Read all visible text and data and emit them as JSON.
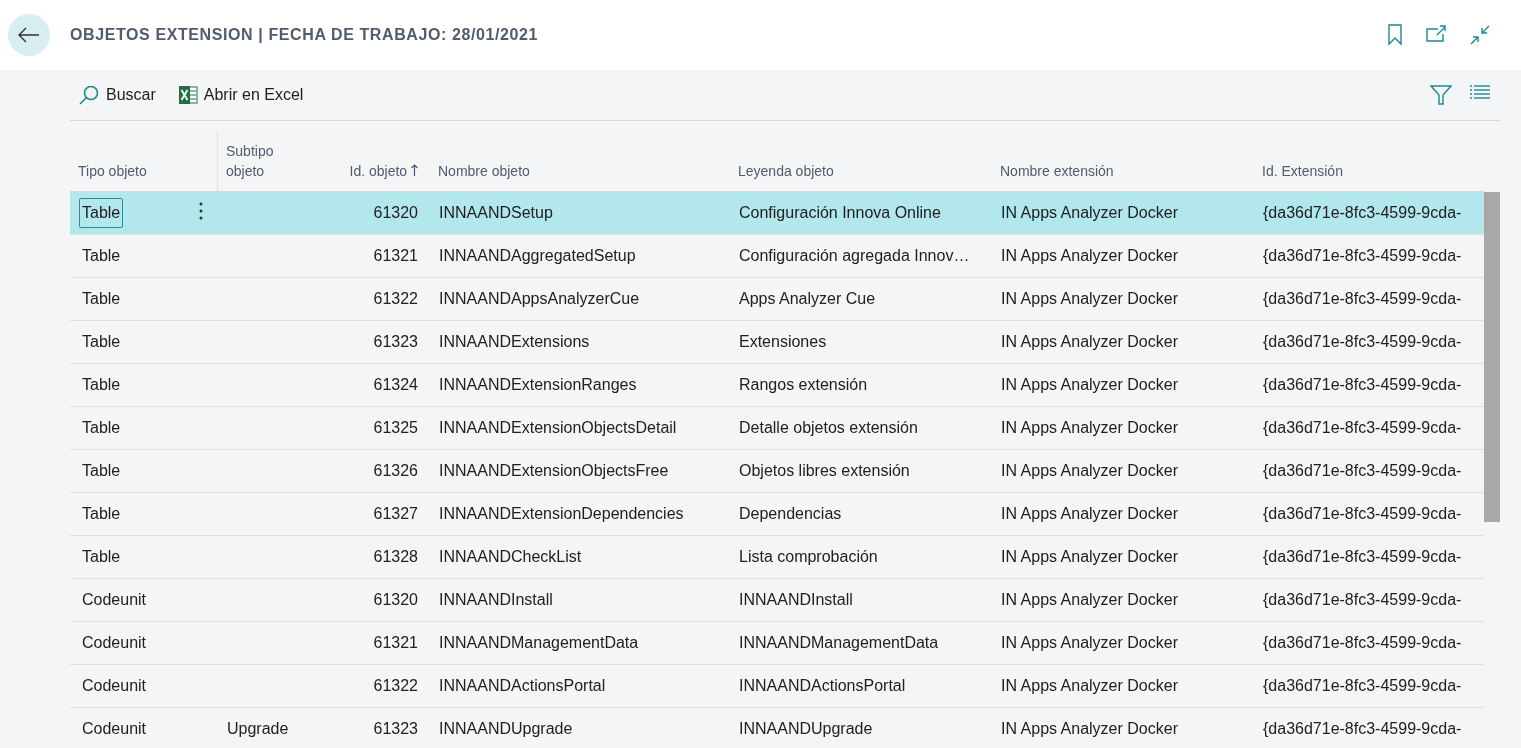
{
  "window": {
    "title": "OBJETOS EXTENSION | FECHA DE TRABAJO: 28/01/2021"
  },
  "toolbar": {
    "actions": [
      {
        "kind": "search",
        "label": "Buscar"
      },
      {
        "kind": "excel",
        "label": "Abrir en Excel"
      }
    ]
  },
  "table": {
    "columns": [
      {
        "label": "Tipo objeto",
        "kind": "text",
        "sorted": false
      },
      {
        "label": "Subtipo objeto",
        "kind": "text",
        "sorted": false
      },
      {
        "label": "Id. objeto",
        "kind": "number",
        "sorted": true
      },
      {
        "label": "Nombre objeto",
        "kind": "text",
        "sorted": false
      },
      {
        "label": "Leyenda objeto",
        "kind": "text",
        "sorted": false
      },
      {
        "label": "Nombre extensión",
        "kind": "text",
        "sorted": false
      },
      {
        "label": "Id. Extensión",
        "kind": "text",
        "sorted": false
      }
    ],
    "rows": [
      {
        "selected": true,
        "cells": [
          "Table",
          "",
          "61320",
          "INNAANDSetup",
          "Configuración Innova Online",
          "IN Apps Analyzer Docker",
          "{da36d71e-8fc3-4599-9cda-"
        ]
      },
      {
        "selected": false,
        "cells": [
          "Table",
          "",
          "61321",
          "INNAANDAggregatedSetup",
          "Configuración agregada Innov…",
          "IN Apps Analyzer Docker",
          "{da36d71e-8fc3-4599-9cda-"
        ]
      },
      {
        "selected": false,
        "cells": [
          "Table",
          "",
          "61322",
          "INNAANDAppsAnalyzerCue",
          "Apps Analyzer Cue",
          "IN Apps Analyzer Docker",
          "{da36d71e-8fc3-4599-9cda-"
        ]
      },
      {
        "selected": false,
        "cells": [
          "Table",
          "",
          "61323",
          "INNAANDExtensions",
          "Extensiones",
          "IN Apps Analyzer Docker",
          "{da36d71e-8fc3-4599-9cda-"
        ]
      },
      {
        "selected": false,
        "cells": [
          "Table",
          "",
          "61324",
          "INNAANDExtensionRanges",
          "Rangos extensión",
          "IN Apps Analyzer Docker",
          "{da36d71e-8fc3-4599-9cda-"
        ]
      },
      {
        "selected": false,
        "cells": [
          "Table",
          "",
          "61325",
          "INNAANDExtensionObjectsDetail",
          "Detalle objetos extensión",
          "IN Apps Analyzer Docker",
          "{da36d71e-8fc3-4599-9cda-"
        ]
      },
      {
        "selected": false,
        "cells": [
          "Table",
          "",
          "61326",
          "INNAANDExtensionObjectsFree",
          "Objetos libres extensión",
          "IN Apps Analyzer Docker",
          "{da36d71e-8fc3-4599-9cda-"
        ]
      },
      {
        "selected": false,
        "cells": [
          "Table",
          "",
          "61327",
          "INNAANDExtensionDependencies",
          "Dependencias",
          "IN Apps Analyzer Docker",
          "{da36d71e-8fc3-4599-9cda-"
        ]
      },
      {
        "selected": false,
        "cells": [
          "Table",
          "",
          "61328",
          "INNAANDCheckList",
          "Lista comprobación",
          "IN Apps Analyzer Docker",
          "{da36d71e-8fc3-4599-9cda-"
        ]
      },
      {
        "selected": false,
        "cells": [
          "Codeunit",
          "",
          "61320",
          "INNAANDInstall",
          "INNAANDInstall",
          "IN Apps Analyzer Docker",
          "{da36d71e-8fc3-4599-9cda-"
        ]
      },
      {
        "selected": false,
        "cells": [
          "Codeunit",
          "",
          "61321",
          "INNAANDManagementData",
          "INNAANDManagementData",
          "IN Apps Analyzer Docker",
          "{da36d71e-8fc3-4599-9cda-"
        ]
      },
      {
        "selected": false,
        "cells": [
          "Codeunit",
          "",
          "61322",
          "INNAANDActionsPortal",
          "INNAANDActionsPortal",
          "IN Apps Analyzer Docker",
          "{da36d71e-8fc3-4599-9cda-"
        ]
      },
      {
        "selected": false,
        "cells": [
          "Codeunit",
          "Upgrade",
          "61323",
          "INNAANDUpgrade",
          "INNAANDUpgrade",
          "IN Apps Analyzer Docker",
          "{da36d71e-8fc3-4599-9cda-"
        ]
      }
    ]
  }
}
